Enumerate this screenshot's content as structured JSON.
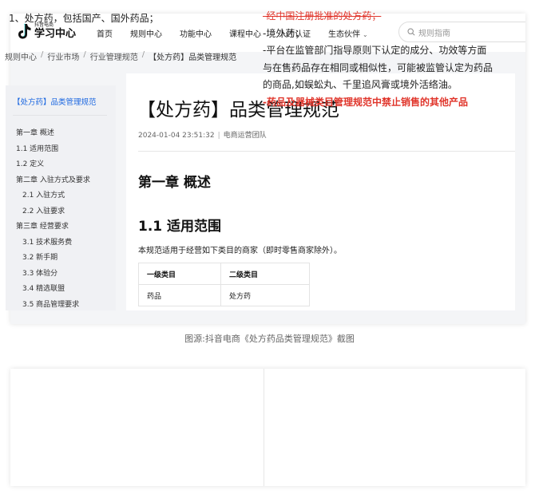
{
  "logo": {
    "small_text": "抖音电商",
    "big_text": "学习中心"
  },
  "nav": {
    "items": [
      "首页",
      "规则中心",
      "功能中心",
      "课程中心",
      "人才认证",
      "生态伙伴"
    ],
    "dropdown_chevron": "chevron-down-icon"
  },
  "search": {
    "placeholder": "规则指南",
    "icon": "search-icon"
  },
  "breadcrumb": [
    "规则中心",
    "行业市场",
    "行业管理规范",
    "【处方药】品类管理规范"
  ],
  "sidebar": {
    "title": "【处方药】品类管理规范",
    "toc": [
      {
        "label": "第一章 概述",
        "level": 1
      },
      {
        "label": "1.1 适用范围",
        "level": 1
      },
      {
        "label": "1.2 定义",
        "level": 1
      },
      {
        "label": "第二章 入驻方式及要求",
        "level": 1
      },
      {
        "label": "2.1 入驻方式",
        "level": 2
      },
      {
        "label": "2.2 入驻要求",
        "level": 2
      },
      {
        "label": "第三章 经营要求",
        "level": 1
      },
      {
        "label": "3.1 技术服务费",
        "level": 2
      },
      {
        "label": "3.2 新手期",
        "level": 2
      },
      {
        "label": "3.3 体验分",
        "level": 2
      },
      {
        "label": "3.4 精选联盟",
        "level": 2
      },
      {
        "label": "3.5 商品管理要求",
        "level": 2
      }
    ]
  },
  "doc": {
    "title": "【处方药】品类管理规范",
    "date": "2024-01-04 23:51:32",
    "author": "电商运营团队",
    "chapter_heading": "第一章 概述",
    "section_heading": "1.1 适用范围",
    "paragraph": "本规范适用于经营如下类目的商家（即时零售商家除外）。",
    "table": {
      "headers": [
        "一级类目",
        "二级类目"
      ],
      "rows": [
        [
          "药品",
          "处方药"
        ]
      ]
    }
  },
  "caption": "图源:抖音电商《处方药品类管理规范》截图",
  "comparison": {
    "left": "1、处方药，包括国产、国外药品；",
    "right": {
      "struck": "-经中国注册批准的处方药；",
      "lines": [
        "-境外药；",
        "-平台在监管部门指导原则下认定的成分、功效等方面",
        "与在售药品存在相同或相似性，可能被监管认定为药品",
        "的商品,如蜈蚣丸、千里追风膏或境外活络油。"
      ],
      "emphasis": "-药品及器械类目管理规范中禁止销售的其他产品"
    }
  },
  "colors": {
    "link_blue": "#1a66e0",
    "emphasis_red": "#e0352b",
    "page_grey": "#f4f5f7"
  }
}
